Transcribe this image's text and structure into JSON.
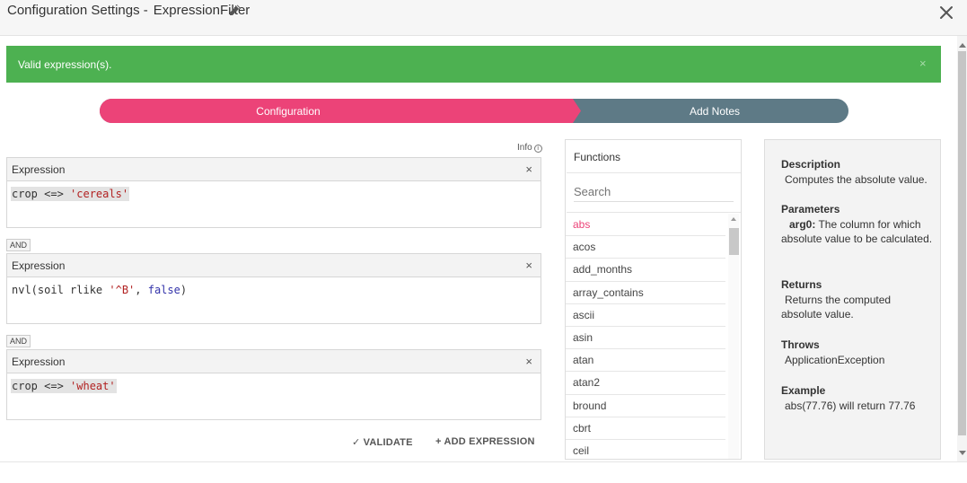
{
  "header": {
    "title": "Configuration Settings -",
    "name": "ExpressionFilter",
    "edit_icon": "pencil-icon",
    "close_icon": "close-icon"
  },
  "alert": {
    "message": "Valid expression(s).",
    "close": "×",
    "color": "#4db151"
  },
  "stepper": {
    "step1": "Configuration",
    "step2": "Add Notes",
    "active_color": "#ec4378",
    "inactive_color": "#5e7a86"
  },
  "info": {
    "label": "Info",
    "icon": "i"
  },
  "expressions": [
    {
      "title": "Expression",
      "close": "×",
      "prefix": "crop <=> ",
      "string": "'cereals'"
    },
    {
      "title": "Expression",
      "close": "×",
      "p1": "nvl(soil rlike ",
      "string": "'^B'",
      "p2": ", ",
      "bool": "false",
      "p3": ")"
    },
    {
      "title": "Expression",
      "close": "×",
      "prefix": "crop <=> ",
      "string": "'wheat'"
    }
  ],
  "and_label": "AND",
  "actions": {
    "validate": "✓ VALIDATE",
    "add": "+ ADD EXPRESSION"
  },
  "functions": {
    "title": "Functions",
    "search_placeholder": "Search",
    "items": [
      "abs",
      "acos",
      "add_months",
      "array_contains",
      "ascii",
      "asin",
      "atan",
      "atan2",
      "bround",
      "cbrt",
      "ceil"
    ],
    "selected": "abs"
  },
  "description": {
    "desc_h": "Description",
    "desc_v": "Computes the absolute value.",
    "params_h": "Parameters",
    "param_name": "arg0:",
    "param_text": " The column for which absolute value to be calculated.",
    "returns_h": "Returns",
    "returns_v": "Returns the computed absolute value.",
    "throws_h": "Throws",
    "throws_v": "ApplicationException",
    "example_h": "Example",
    "example_v": "abs(77.76) will return 77.76"
  }
}
